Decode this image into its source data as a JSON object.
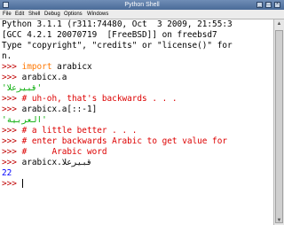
{
  "window": {
    "title": "Python Shell",
    "controls": [
      "_",
      "□",
      "×"
    ]
  },
  "menu": [
    "File",
    "Edit",
    "Shell",
    "Debug",
    "Options",
    "Windows"
  ],
  "shell": {
    "prompt": ">>>",
    "banner": [
      "Python 3.1.1 (r311:74480, Oct  3 2009, 21:55:3",
      "[GCC 4.2.1 20070719  [FreeBSD]] on freebsd7",
      "Type \"copyright\", \"credits\" or \"license()\" for",
      "n."
    ],
    "s1_kw": "import",
    "s1_rest": " arabicx",
    "s2": " arabicx.a",
    "r2": "'قبيرعلا'",
    "s3": " # uh-oh, that's backwards . . .",
    "s4": " arabicx.a[::-1]",
    "r4": "'العربية'",
    "s5": " # a little better . . .",
    "s6": " # enter backwards Arabic to get value for",
    "s7": " #     Arabic word",
    "s8": " arabicx.قبيرعلا",
    "r8": "22"
  }
}
